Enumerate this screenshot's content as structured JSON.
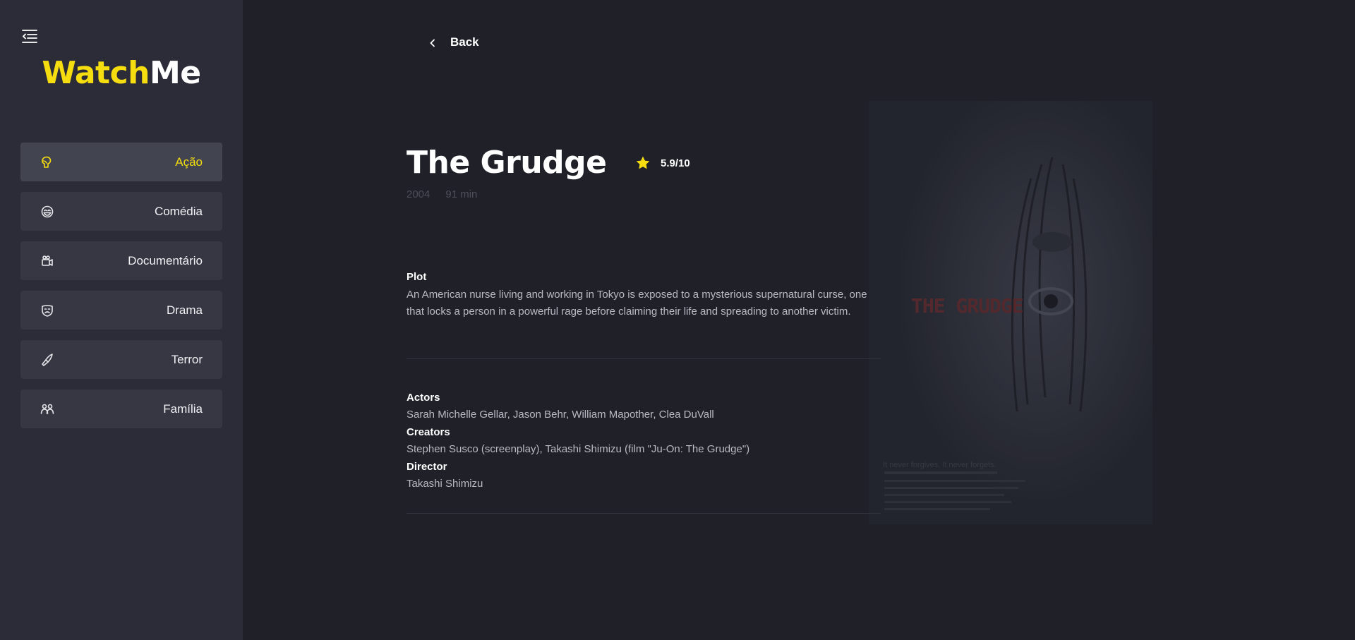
{
  "app": {
    "logo_part_a": "Watch",
    "logo_part_b": "Me",
    "accent_color": "#f5dd0f"
  },
  "sidebar": {
    "menu_icon": "menu-collapse-icon",
    "genres": [
      {
        "label": "Ação",
        "icon": "boxing-glove-icon",
        "active": true
      },
      {
        "label": "Comédia",
        "icon": "laughing-face-icon",
        "active": false
      },
      {
        "label": "Documentário",
        "icon": "camera-icon",
        "active": false
      },
      {
        "label": "Drama",
        "icon": "mask-icon",
        "active": false
      },
      {
        "label": "Terror",
        "icon": "knife-icon",
        "active": false
      },
      {
        "label": "Família",
        "icon": "family-icon",
        "active": false
      }
    ]
  },
  "main": {
    "back_label": "Back",
    "movie": {
      "title": "The Grudge",
      "rating": "5.9/10",
      "year": "2004",
      "runtime": "91 min",
      "plot_heading": "Plot",
      "plot": "An American nurse living and working in Tokyo is exposed to a mysterious supernatural curse, one that locks a person in a powerful rage before claiming their life and spreading to another victim.",
      "actors_heading": "Actors",
      "actors": "Sarah Michelle Gellar, Jason Behr, William Mapother, Clea DuVall",
      "creators_heading": "Creators",
      "creators": "Stephen Susco (screenplay), Takashi Shimizu (film \"Ju-On: The Grudge\")",
      "director_heading": "Director",
      "director": "Takashi Shimizu"
    },
    "poster": {
      "title": "THE GRUDGE",
      "tagline": "It never forgives. It never forgets."
    }
  }
}
